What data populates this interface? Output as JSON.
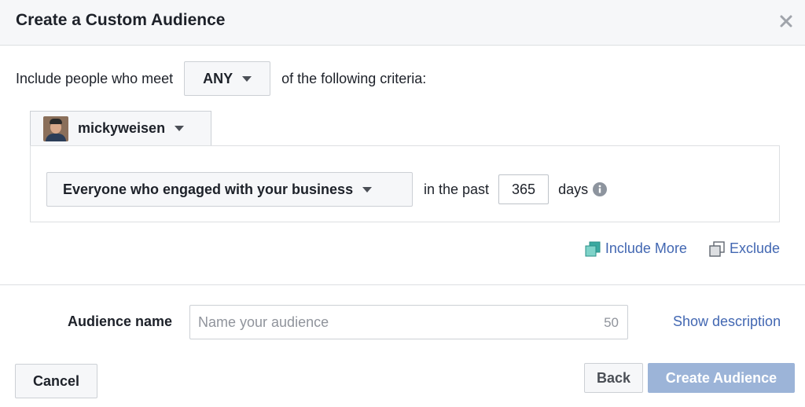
{
  "dialog": {
    "title": "Create a Custom Audience"
  },
  "criteria": {
    "prefix": "Include people who meet",
    "match_value": "ANY",
    "suffix": "of the following criteria:"
  },
  "source": {
    "account_name": "mickyweisen"
  },
  "rule": {
    "event_label": "Everyone who engaged with your business",
    "in_past_label": "in the past",
    "days_value": "365",
    "days_label": "days"
  },
  "actions": {
    "include_more": "Include More",
    "exclude": "Exclude"
  },
  "audience_name": {
    "label": "Audience name",
    "placeholder": "Name your audience",
    "char_limit": "50",
    "show_description": "Show description"
  },
  "footer": {
    "cancel": "Cancel",
    "back": "Back",
    "create": "Create Audience"
  },
  "colors": {
    "link": "#4267b2",
    "create_disabled": "#9cb4d8",
    "include_icon": "#3aa9a0"
  }
}
